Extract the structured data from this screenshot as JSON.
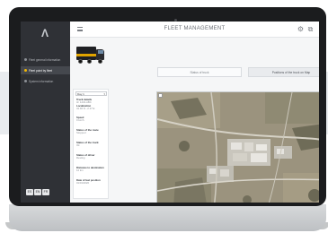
{
  "app": {
    "title": "FLEET MANAGEMENT"
  },
  "sidebar": {
    "items": [
      {
        "label": "Fleet general information"
      },
      {
        "label": "Fleet point by fleet"
      },
      {
        "label": "System information"
      }
    ]
  },
  "info_panel": {
    "select_value": "Day 1",
    "blocks": [
      {
        "label": "Truck details",
        "lines": [
          "Id: 1234-ABC",
          "Localization",
          "41.40 N - 2.17 E"
        ]
      },
      {
        "label": "Speed",
        "lines": [
          "0 km/h"
        ]
      },
      {
        "label": "Status of the route",
        "lines": [
          "Stopped"
        ]
      },
      {
        "label": "Status of the truck",
        "lines": [
          "Ok"
        ]
      },
      {
        "label": "Status of driver",
        "lines": [
          "Resting"
        ]
      },
      {
        "label": "Distance to destination",
        "lines": [
          "12 km"
        ]
      },
      {
        "label": "Date of last position",
        "lines": [
          "01/01/2020"
        ]
      }
    ]
  },
  "actions": {
    "primary_label": "Status of truck",
    "secondary_label": "Positions of the truck on Map"
  },
  "languages": [
    "ES",
    "EN",
    "FR"
  ],
  "colors": {
    "sidebar_bg": "#2f3136",
    "accent": "#f2b705",
    "screen_bg": "#f5f6f7"
  }
}
